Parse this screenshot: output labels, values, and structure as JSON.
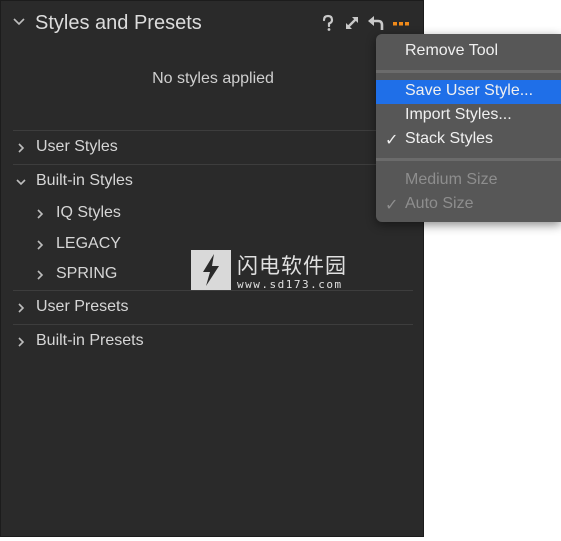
{
  "panel": {
    "title": "Styles and Presets",
    "empty_message": "No styles applied",
    "header_icons": [
      "help-icon",
      "expand-icon",
      "reset-icon",
      "more-options-icon"
    ],
    "accent_color": "#f08a1a"
  },
  "tree": {
    "user_styles": "User Styles",
    "builtin_styles": "Built-in Styles",
    "iq_styles": "IQ Styles",
    "legacy": "LEGACY",
    "spring": "SPRING",
    "user_presets": "User Presets",
    "builtin_presets": "Built-in Presets"
  },
  "menu": {
    "remove_tool": "Remove Tool",
    "save_user_style": "Save User Style...",
    "import_styles": "Import Styles...",
    "stack_styles": "Stack Styles",
    "stack_styles_checked": true,
    "medium_size": "Medium Size",
    "auto_size": "Auto Size",
    "auto_size_checked": true,
    "checkmark": "✓",
    "selected_color": "#1f6fe8"
  },
  "watermark": {
    "title": "闪电软件园",
    "url": "www.sd173.com"
  }
}
